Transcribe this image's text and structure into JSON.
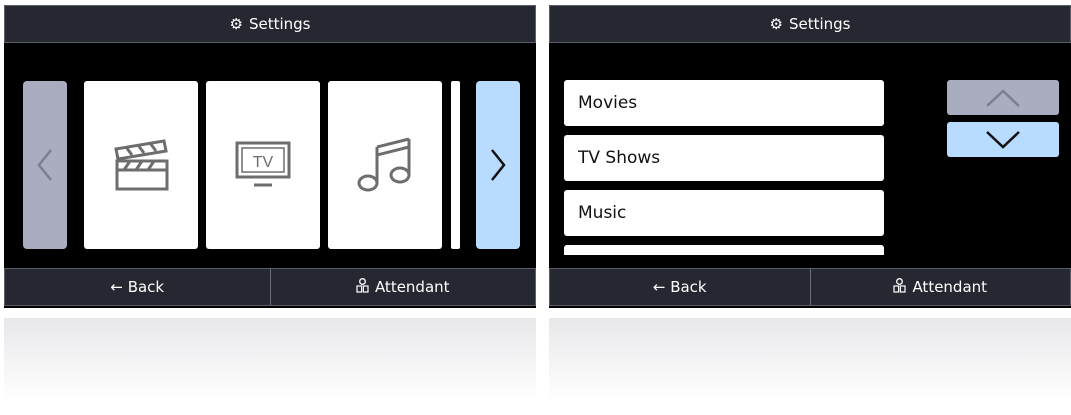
{
  "left_screen": {
    "title": "Settings",
    "title_icon": "gear-icon",
    "tiles": [
      {
        "name": "movies",
        "icon": "clapperboard-icon"
      },
      {
        "name": "tv",
        "icon": "tv-icon",
        "icon_text": "TV"
      },
      {
        "name": "music",
        "icon": "music-note-icon"
      }
    ],
    "back_label": "← Back",
    "attendant_label": "Attendant",
    "attendant_icon": "attendant-icon"
  },
  "right_screen": {
    "title": "Settings",
    "title_icon": "gear-icon",
    "items": [
      "Movies",
      "TV Shows",
      "Music"
    ],
    "back_label": "← Back",
    "attendant_label": "Attendant",
    "attendant_icon": "attendant-icon"
  },
  "colors": {
    "background": "#000000",
    "bar": "#252830",
    "inactive_nav": "#a9adbf",
    "active_nav": "#b8dcff",
    "tile": "#ffffff"
  }
}
